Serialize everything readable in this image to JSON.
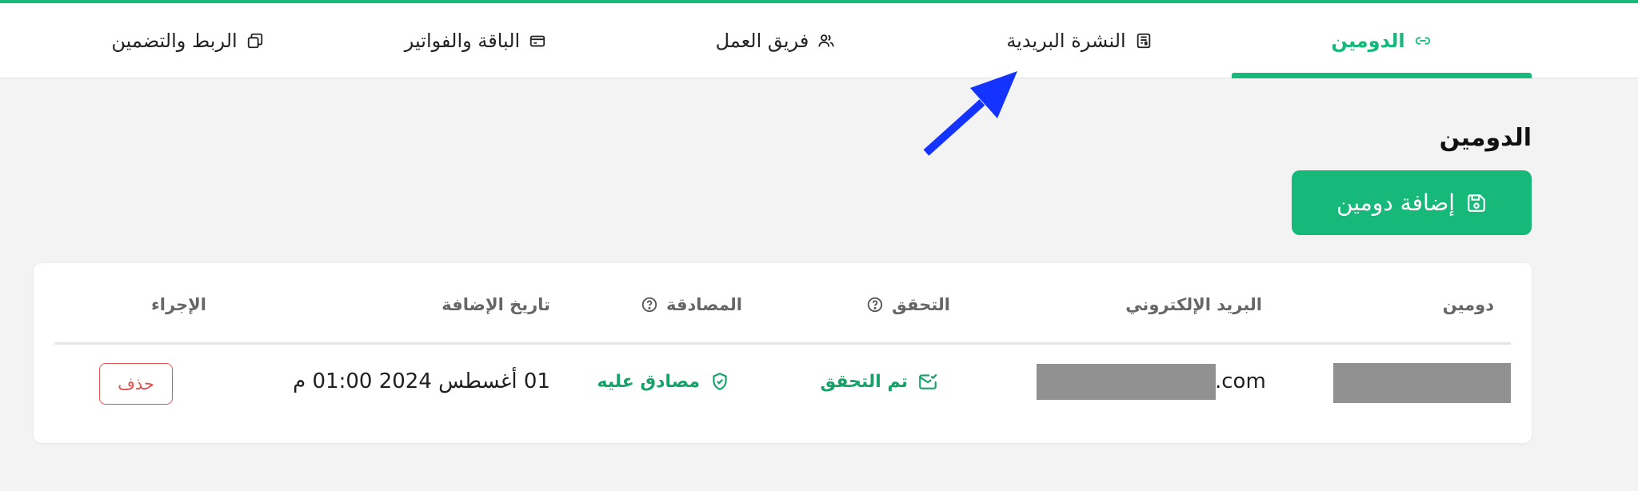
{
  "tabs": [
    {
      "label": "الدومين",
      "icon": "link-icon",
      "active": true
    },
    {
      "label": "النشرة البريدية",
      "icon": "newsletter-icon",
      "active": false
    },
    {
      "label": "فريق العمل",
      "icon": "users-icon",
      "active": false
    },
    {
      "label": "الباقة والفواتير",
      "icon": "credit-card-icon",
      "active": false
    },
    {
      "label": "الربط والتضمين",
      "icon": "stack-icon",
      "active": false
    }
  ],
  "page": {
    "title": "الدومين",
    "add_button_label": "إضافة دومين"
  },
  "table": {
    "headers": {
      "domain": "دومين",
      "email": "البريد الإلكتروني",
      "verification": "التحقق",
      "authentication": "المصادقة",
      "added_date": "تاريخ الإضافة",
      "action": "الإجراء"
    },
    "rows": [
      {
        "email_suffix": ".com",
        "verification_status": "تم التحقق",
        "authentication_status": "مصادق عليه",
        "added_date": "01 أغسطس 2024 01:00 م",
        "delete_label": "حذف"
      }
    ]
  },
  "colors": {
    "accent": "#17b97a",
    "status_green": "#16a36a",
    "danger": "#e05252",
    "annotation_arrow": "#1433ff"
  }
}
